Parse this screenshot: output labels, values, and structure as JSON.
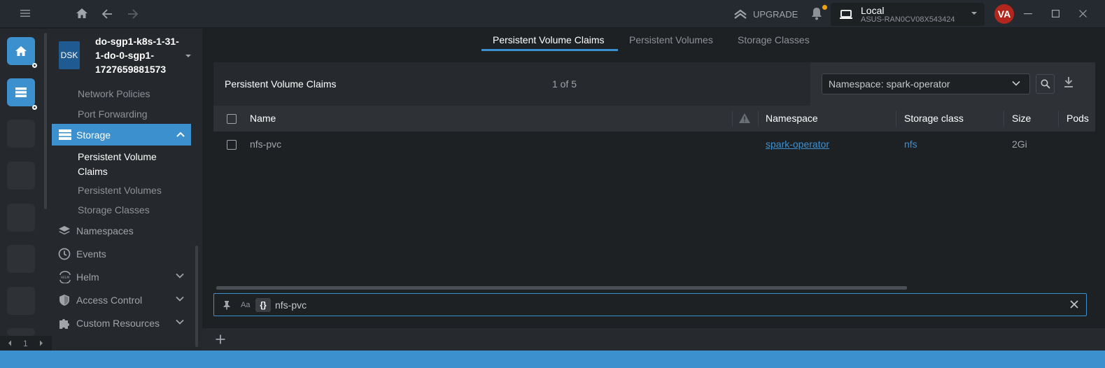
{
  "topbar": {
    "upgrade_label": "UPGRADE",
    "cluster_name": "Local",
    "cluster_host": "ASUS-RAN0CV08X543424",
    "avatar_initials": "VA",
    "notification_dot_color": "#f1a10f"
  },
  "hotbar": {
    "page": "1"
  },
  "sidebar": {
    "badge": "DSK",
    "cluster_title": "do-sgp1-k8s-1-31-1-do-0-sgp1-1727659881573",
    "items_before": [
      {
        "label": "Network Policies"
      },
      {
        "label": "Port Forwarding"
      }
    ],
    "storage": {
      "label": "Storage",
      "children": [
        {
          "label": "Persistent Volume Claims",
          "active": true
        },
        {
          "label": "Persistent Volumes"
        },
        {
          "label": "Storage Classes"
        }
      ]
    },
    "items_after": [
      {
        "label": "Namespaces",
        "icon": "layers-icon"
      },
      {
        "label": "Events",
        "icon": "clock-icon"
      },
      {
        "label": "Helm",
        "icon": "helm-icon",
        "expandable": true
      },
      {
        "label": "Access Control",
        "icon": "shield-icon",
        "expandable": true
      },
      {
        "label": "Custom Resources",
        "icon": "puzzle-icon",
        "expandable": true
      }
    ]
  },
  "tabs": [
    {
      "label": "Persistent Volume Claims",
      "active": true
    },
    {
      "label": "Persistent Volumes"
    },
    {
      "label": "Storage Classes"
    }
  ],
  "panel": {
    "title": "Persistent Volume Claims",
    "count": "1 of 5",
    "namespace_select": "Namespace: spark-operator"
  },
  "table": {
    "columns": [
      "Name",
      "Namespace",
      "Storage class",
      "Size",
      "Pods"
    ],
    "rows": [
      {
        "name": "nfs-pvc",
        "namespace": "spark-operator",
        "storage_class": "nfs",
        "size": "2Gi",
        "pods": ""
      }
    ]
  },
  "search": {
    "case_label": "Aa",
    "regex_label": "{}",
    "value": "nfs-pvc"
  },
  "colors": {
    "accent": "#3d90ce",
    "avatar": "#b3261e"
  }
}
